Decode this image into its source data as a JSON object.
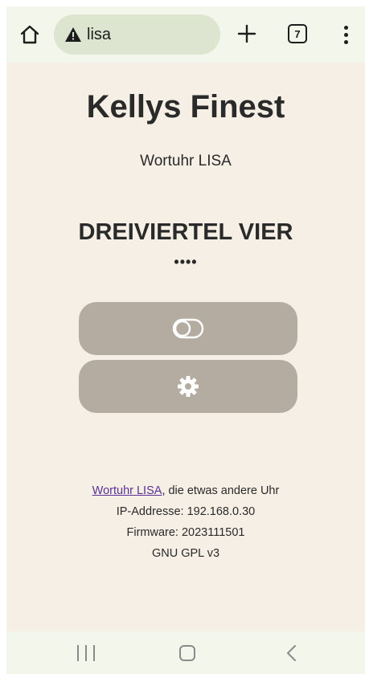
{
  "browser": {
    "url": "lisa",
    "tab_count": "7",
    "icons": {
      "home": "home-icon",
      "warning": "warning-icon",
      "new_tab": "plus-icon",
      "tabs": "tab-switcher-icon",
      "menu": "more-vert-icon"
    }
  },
  "page": {
    "title": "Kellys Finest",
    "subtitle": "Wortuhr LISA",
    "time_words": "DREIVIERTEL VIER",
    "minute_dots": "••••",
    "buttons": [
      {
        "icon": "toggle-icon"
      },
      {
        "icon": "gear-icon"
      }
    ],
    "footer": {
      "link_text": "Wortuhr LISA",
      "link_suffix": ", die etwas andere Uhr",
      "ip_line": "IP-Addresse: 192.168.0.30",
      "firmware_line": "Firmware: 2023111501",
      "license_line": "GNU GPL v3"
    },
    "colors": {
      "background": "#f6efe6",
      "button": "#b5aca1",
      "link": "#5a3196"
    }
  },
  "navbar": {
    "icons": [
      "recent-apps-icon",
      "home-icon",
      "back-icon"
    ]
  }
}
